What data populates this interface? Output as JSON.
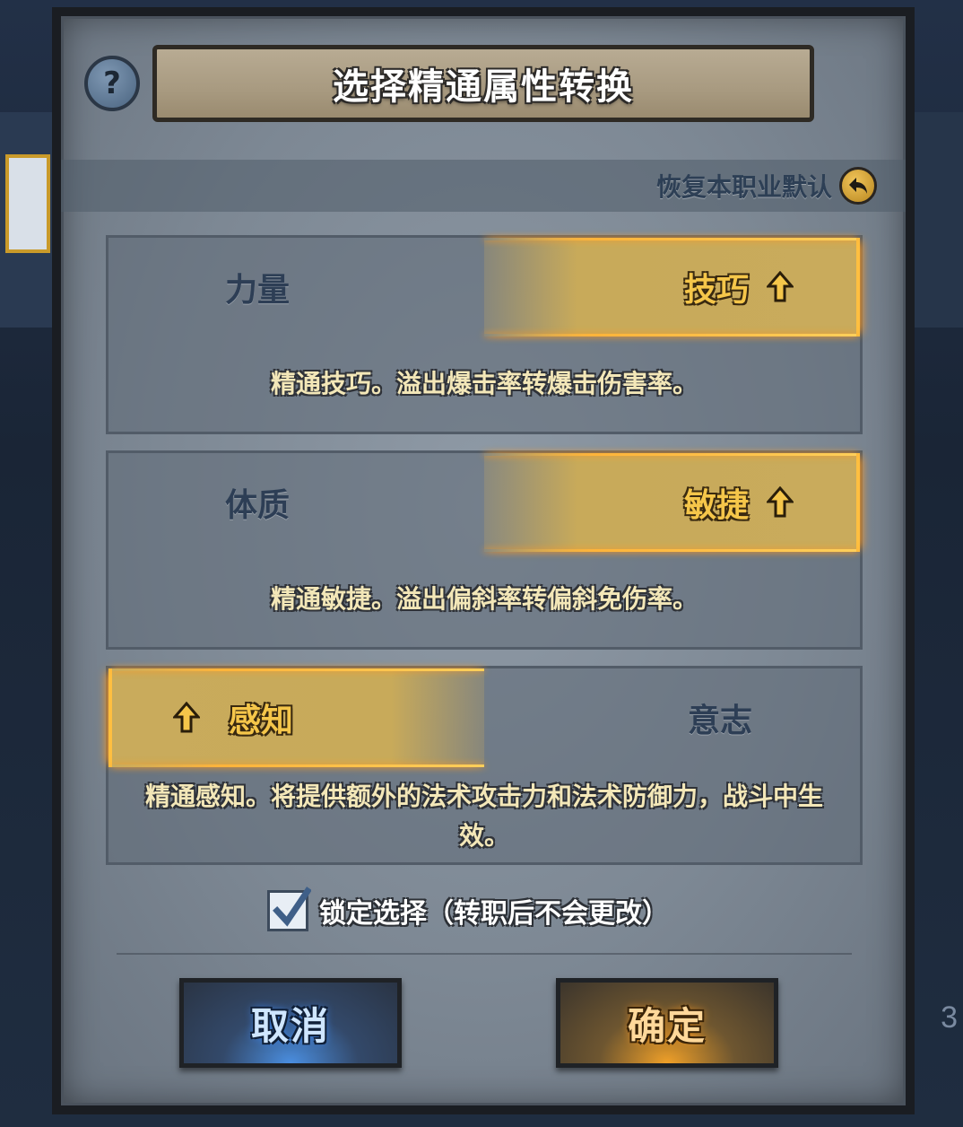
{
  "dialog": {
    "title": "选择精通属性转换",
    "help_icon": "question-icon",
    "reset_label": "恢复本职业默认",
    "reset_icon": "undo-arrow-icon"
  },
  "cards": [
    {
      "left": {
        "label": "力量",
        "selected": false
      },
      "right": {
        "label": "技巧",
        "selected": true
      },
      "description": "精通技巧。溢出爆击率转爆击伤害率。"
    },
    {
      "left": {
        "label": "体质",
        "selected": false
      },
      "right": {
        "label": "敏捷",
        "selected": true
      },
      "description": "精通敏捷。溢出偏斜率转偏斜免伤率。"
    },
    {
      "left": {
        "label": "感知",
        "selected": true
      },
      "right": {
        "label": "意志",
        "selected": false
      },
      "description": "精通感知。将提供额外的法术攻击力和法术防御力，战斗中生效。"
    }
  ],
  "lock": {
    "label": "锁定选择（转职后不会更改）",
    "checked": true
  },
  "buttons": {
    "cancel": "取消",
    "confirm": "确定"
  },
  "background": {
    "page_indicator": "3"
  },
  "colors": {
    "selected_gold": "#c9ab5c",
    "selected_text": "#f5c64a",
    "unselected_text": "#2d3e55",
    "glow": "#ffb43a"
  }
}
